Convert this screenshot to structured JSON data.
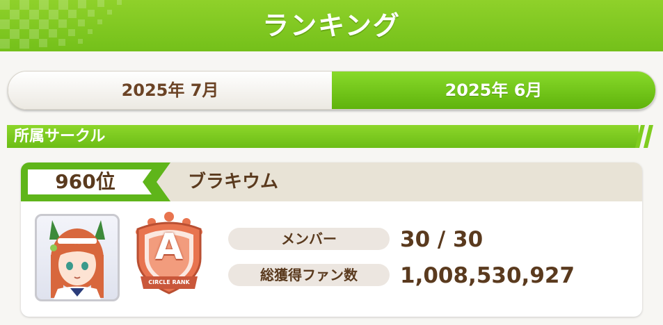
{
  "header": {
    "title": "ランキング"
  },
  "tabs": [
    {
      "label": "2025年 7月",
      "active": false
    },
    {
      "label": "2025年 6月",
      "active": true
    }
  ],
  "section": {
    "title": "所属サークル"
  },
  "circle": {
    "rank": "960位",
    "name": "ブラキウム",
    "emblem": {
      "letter": "A",
      "caption": "CIRCLE RANK"
    },
    "stats": [
      {
        "label": "メンバー",
        "value": "30 / 30"
      },
      {
        "label": "総獲得ファン数",
        "value": "1,008,530,927"
      }
    ]
  },
  "colors": {
    "accent_green": "#74c01a",
    "text_brown": "#5a3a1e",
    "emblem_orange": "#e8744f"
  },
  "icons": {
    "avatar": "character-portrait-icon",
    "emblem": "circle-rank-emblem-icon"
  }
}
